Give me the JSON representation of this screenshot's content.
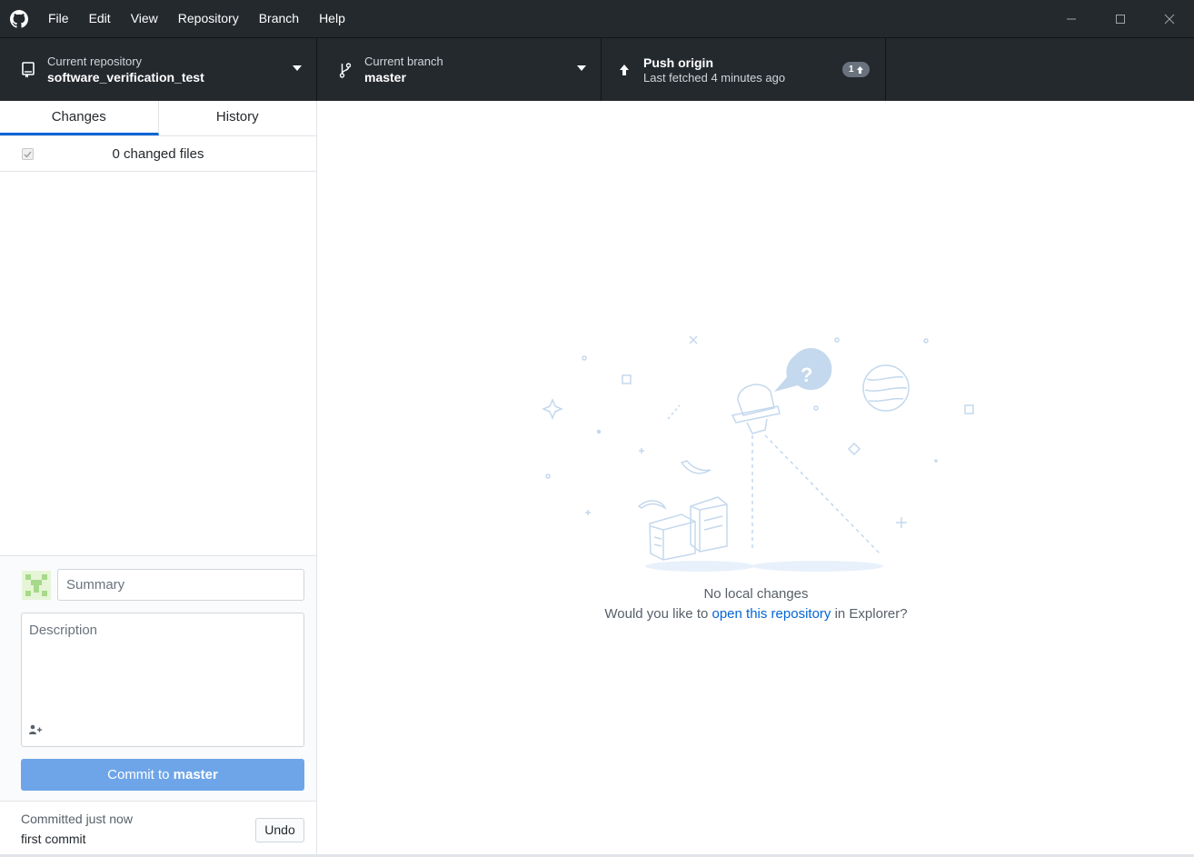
{
  "menu": {
    "app_icon": "github-octocat-icon",
    "items": [
      "File",
      "Edit",
      "View",
      "Repository",
      "Branch",
      "Help"
    ]
  },
  "toolbar": {
    "repo": {
      "label": "Current repository",
      "value": "software_verification_test",
      "icon": "repo-icon"
    },
    "branch": {
      "label": "Current branch",
      "value": "master",
      "icon": "git-branch-icon"
    },
    "push": {
      "label": "Push origin",
      "sub": "Last fetched 4 minutes ago",
      "badge": "1",
      "icon": "arrow-up-icon"
    }
  },
  "sidebar": {
    "tabs": [
      "Changes",
      "History"
    ],
    "active_tab": "Changes",
    "changed_files": "0 changed files",
    "summary_placeholder": "Summary",
    "description_placeholder": "Description",
    "commit_button_prefix": "Commit to ",
    "commit_button_branch": "master",
    "last_commit_title": "Committed just now",
    "last_commit_message": "first commit",
    "undo_label": "Undo"
  },
  "main": {
    "empty_title": "No local changes",
    "explorer_prefix": "Would you like to ",
    "explorer_link": "open this repository",
    "explorer_suffix": " in Explorer?"
  },
  "colors": {
    "titlebar": "#24292e",
    "accent": "#0366d6",
    "commit_button": "#6ea5e8"
  }
}
